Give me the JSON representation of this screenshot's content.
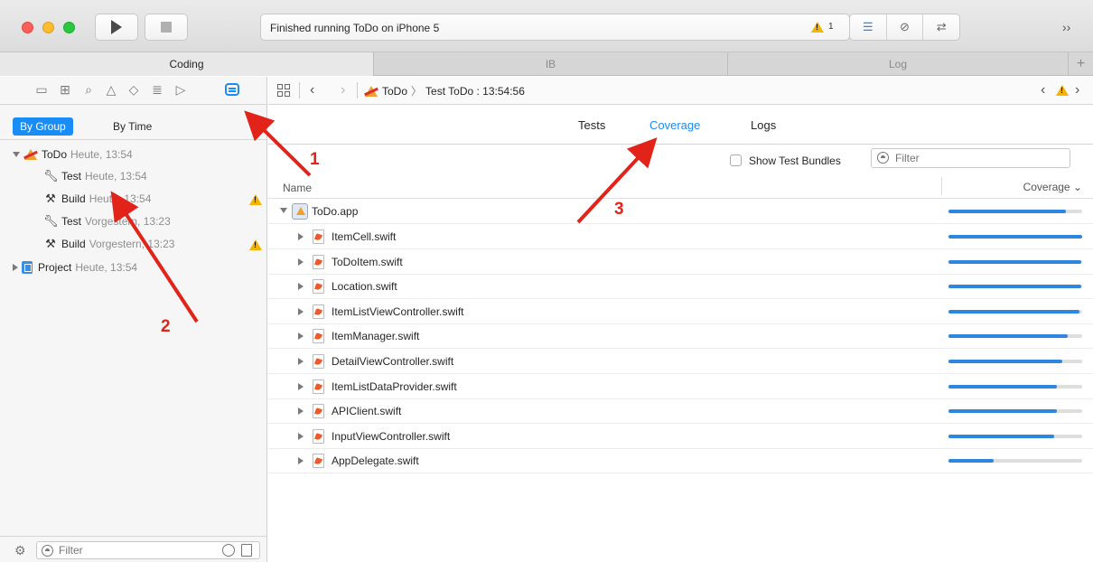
{
  "toolbar": {
    "run_icon": "play-icon",
    "stop_icon": "stop-icon",
    "activity_text": "Finished running ToDo on iPhone 5",
    "warning_count": "1",
    "editor_modes": [
      "standard-editor-icon",
      "assistant-editor-icon",
      "version-editor-icon"
    ],
    "overflow": "››"
  },
  "tabs": [
    {
      "label": "Coding",
      "active": true
    },
    {
      "label": "IB",
      "active": false
    },
    {
      "label": "Log",
      "active": false
    }
  ],
  "tab_add": "+",
  "sidebar": {
    "nav_icons": [
      "folder-icon",
      "hierarchy-icon",
      "search-icon",
      "warning-icon",
      "test-icon",
      "debug-icon",
      "breakpoint-icon",
      "report-icon"
    ],
    "segment": {
      "by_group": "By Group",
      "by_time": "By Time"
    },
    "tree": [
      {
        "label": "ToDo",
        "sub": "Heute, 13:54"
      },
      {
        "label": "Test",
        "sub": "Heute, 13:54"
      },
      {
        "label": "Build",
        "sub": "Heute, 13:54",
        "warning": true
      },
      {
        "label": "Test",
        "sub": "Vorgestern, 13:23"
      },
      {
        "label": "Build",
        "sub": "Vorgestern, 13:23",
        "warning": true
      },
      {
        "label": "Project",
        "sub": "Heute, 13:54"
      }
    ],
    "filter_placeholder": "Filter"
  },
  "jumpbar": {
    "crumb_project": "ToDo",
    "crumb_report": "Test ToDo : 13:54:56"
  },
  "report_tabs": [
    {
      "label": "Tests",
      "active": false
    },
    {
      "label": "Coverage",
      "active": true
    },
    {
      "label": "Logs",
      "active": false
    }
  ],
  "coverage": {
    "show_bundles_label": "Show Test Bundles",
    "filter_placeholder": "Filter",
    "col_name": "Name",
    "col_coverage": "Coverage ⌄",
    "target": {
      "name": "ToDo.app",
      "coverage": 0.88
    },
    "files": [
      {
        "name": "ItemCell.swift",
        "coverage": 1.0
      },
      {
        "name": "ToDoItem.swift",
        "coverage": 0.99
      },
      {
        "name": "Location.swift",
        "coverage": 0.99
      },
      {
        "name": "ItemListViewController.swift",
        "coverage": 0.98
      },
      {
        "name": "ItemManager.swift",
        "coverage": 0.89
      },
      {
        "name": "DetailViewController.swift",
        "coverage": 0.85
      },
      {
        "name": "ItemListDataProvider.swift",
        "coverage": 0.81
      },
      {
        "name": "APIClient.swift",
        "coverage": 0.81
      },
      {
        "name": "InputViewController.swift",
        "coverage": 0.79
      },
      {
        "name": "AppDelegate.swift",
        "coverage": 0.34
      }
    ]
  },
  "annotations": [
    "1",
    "2",
    "3"
  ],
  "colors": {
    "accent": "#1a8cf5",
    "annotation": "#e2231a",
    "coverage_bar": "#2f86df",
    "warning": "#f5b400"
  }
}
